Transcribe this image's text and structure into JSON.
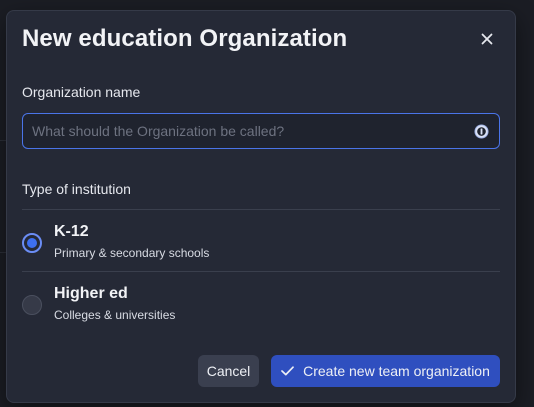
{
  "dialog": {
    "title": "New education Organization",
    "close_icon": "close-icon"
  },
  "name_field": {
    "label": "Organization name",
    "placeholder": "What should the Organization be called?",
    "value": "",
    "password_manager_icon": "password-manager-icon"
  },
  "institution": {
    "label": "Type of institution",
    "options": [
      {
        "title": "K-12",
        "subtitle": "Primary & secondary schools",
        "checked": true
      },
      {
        "title": "Higher ed",
        "subtitle": "Colleges & universities",
        "checked": false
      }
    ]
  },
  "actions": {
    "cancel_label": "Cancel",
    "create_label": "Create new team organization",
    "create_icon": "check-icon"
  },
  "colors": {
    "accent": "#3d6ff0",
    "primary_button": "#2f4fbf",
    "dialog_bg": "#252936"
  }
}
